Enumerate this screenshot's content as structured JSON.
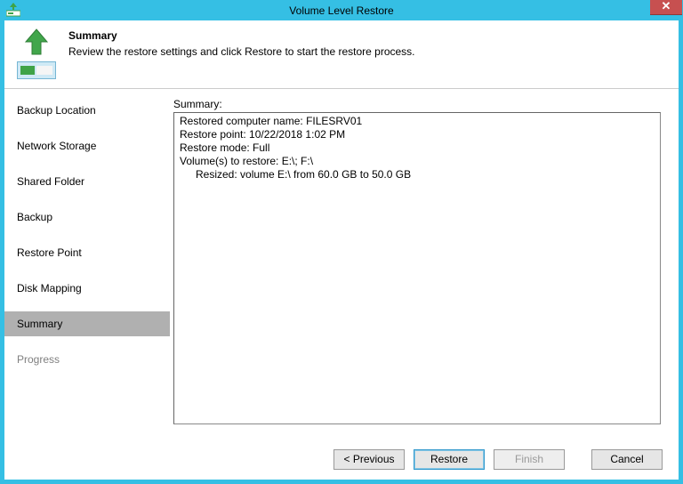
{
  "window": {
    "title": "Volume Level Restore"
  },
  "header": {
    "title": "Summary",
    "subtitle": "Review the restore settings and click Restore to start the restore process."
  },
  "sidebar": {
    "items": [
      {
        "label": "Backup Location",
        "state": "normal"
      },
      {
        "label": "Network Storage",
        "state": "normal"
      },
      {
        "label": "Shared Folder",
        "state": "normal"
      },
      {
        "label": "Backup",
        "state": "normal"
      },
      {
        "label": "Restore Point",
        "state": "normal"
      },
      {
        "label": "Disk Mapping",
        "state": "normal"
      },
      {
        "label": "Summary",
        "state": "selected"
      },
      {
        "label": "Progress",
        "state": "disabled"
      }
    ]
  },
  "main": {
    "label": "Summary:",
    "lines": [
      "Restored computer name: FILESRV01",
      "Restore point: 10/22/2018 1:02 PM",
      "Restore mode: Full",
      "Volume(s) to restore: E:\\; F:\\"
    ],
    "indented": [
      "Resized: volume E:\\ from 60.0 GB to 50.0 GB"
    ]
  },
  "footer": {
    "previous": "< Previous",
    "restore": "Restore",
    "finish": "Finish",
    "cancel": "Cancel"
  },
  "colors": {
    "accent": "#35BFE4",
    "close": "#C75050",
    "green": "#3fa347"
  }
}
